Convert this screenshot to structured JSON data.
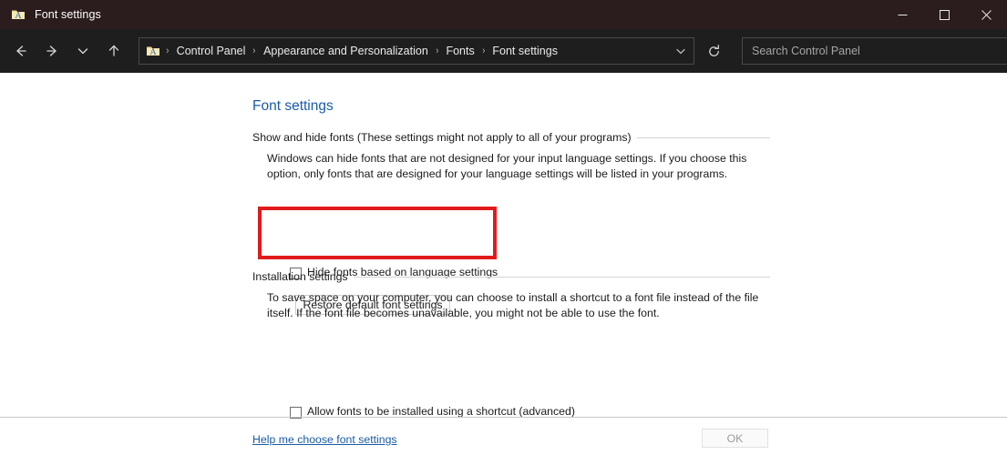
{
  "window": {
    "title": "Font settings",
    "app_icon": "folder-font-icon",
    "controls": {
      "minimize": "minimize-icon",
      "maximize": "maximize-icon",
      "close": "close-icon"
    },
    "colors": {
      "titlebar_bg": "#2b1d1d",
      "toolbar_bg": "#1e1e1e",
      "content_bg": "#ffffff",
      "link": "#1a5ba6",
      "highlight": "#e01b1b"
    }
  },
  "toolbar": {
    "back_icon": "back-arrow-icon",
    "forward_icon": "forward-arrow-icon",
    "recent_icon": "chevron-down-icon",
    "up_icon": "up-arrow-icon",
    "refresh_icon": "refresh-icon",
    "address_icon": "folder-font-icon",
    "breadcrumbs": [
      "Control Panel",
      "Appearance and Personalization",
      "Fonts",
      "Font settings"
    ],
    "breadcrumb_separator": "›",
    "address_dropdown_icon": "chevron-down-icon"
  },
  "search": {
    "placeholder": "Search Control Panel",
    "icon": "search-icon"
  },
  "main": {
    "page_title": "Font settings",
    "sections": [
      {
        "heading": "Show and hide fonts (These settings might not apply to all of your programs)",
        "paragraph": "Windows can hide fonts that are not designed for your input language settings. If you choose this option, only fonts that are designed for your language settings will be listed in your programs.",
        "checkbox_label": "Hide fonts based on language settings",
        "checkbox_checked": false,
        "button_label": "Restore default font settings"
      },
      {
        "heading": "Installation settings",
        "paragraph": "To save space on your computer, you can choose to install a shortcut to a font file instead of the file itself. If the font file becomes unavailable, you might not be able to use the font.",
        "checkbox_label": "Allow fonts to be installed using a shortcut (advanced)",
        "checkbox_checked": false
      }
    ],
    "help_link": "Help me choose font settings"
  },
  "footer": {
    "ok_label": "OK",
    "ok_enabled": false
  }
}
